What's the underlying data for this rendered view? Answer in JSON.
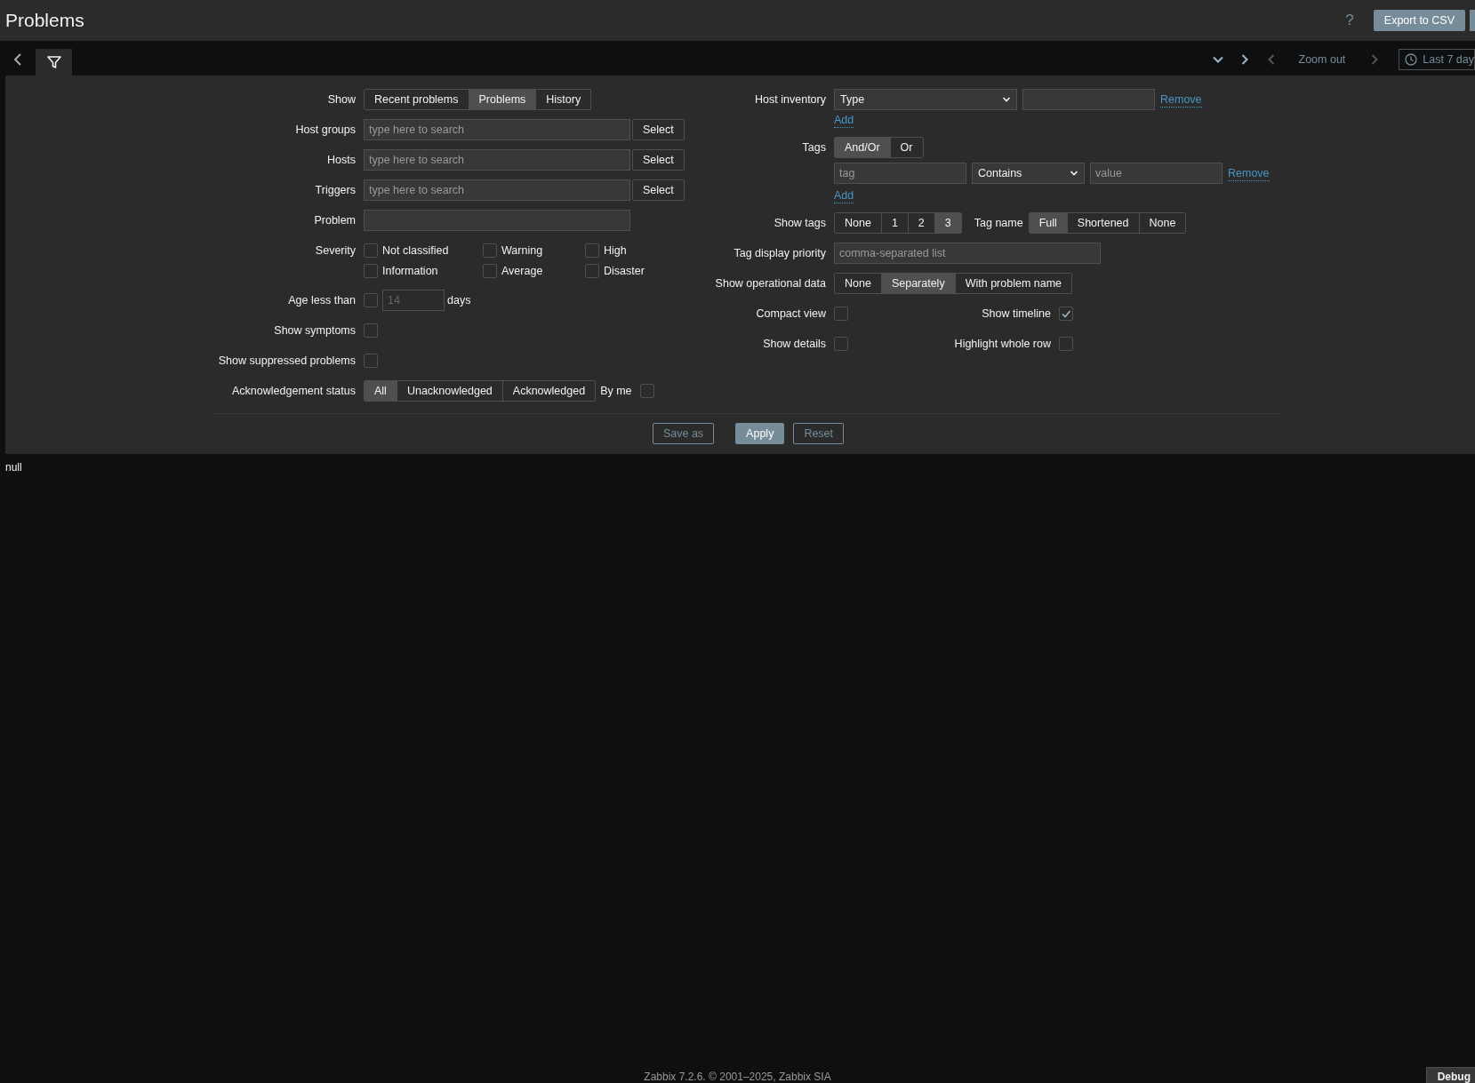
{
  "header": {
    "title": "Problems",
    "help": "?",
    "export_button": "Export to CSV"
  },
  "tab_bar": {
    "tabs": [
      {
        "kind": "filter",
        "selected": true
      }
    ],
    "zoom_out": "Zoom out",
    "time_range": "Last 7 day"
  },
  "filter": {
    "left": [
      {
        "kind": "segmented",
        "label": "Show",
        "options": [
          {
            "label": "Recent problems",
            "selected": false
          },
          {
            "label": "Problems",
            "selected": true
          },
          {
            "label": "History",
            "selected": false
          }
        ]
      },
      {
        "kind": "multiselect",
        "label": "Host groups",
        "placeholder": "type here to search",
        "button": "Select"
      },
      {
        "kind": "multiselect",
        "label": "Hosts",
        "placeholder": "type here to search",
        "button": "Select"
      },
      {
        "kind": "multiselect",
        "label": "Triggers",
        "placeholder": "type here to search",
        "button": "Select"
      },
      {
        "kind": "text",
        "label": "Problem"
      },
      {
        "kind": "checkgrid",
        "label": "Severity",
        "options": [
          {
            "label": "Not classified",
            "checked": false
          },
          {
            "label": "Warning",
            "checked": false
          },
          {
            "label": "High",
            "checked": false
          },
          {
            "label": "Information",
            "checked": false
          },
          {
            "label": "Average",
            "checked": false
          },
          {
            "label": "Disaster",
            "checked": false
          }
        ]
      },
      {
        "kind": "age",
        "label": "Age less than",
        "checked": false,
        "value": "14",
        "disabled": true,
        "unit": "days"
      },
      {
        "kind": "checkbox",
        "label": "Show symptoms",
        "checked": false
      },
      {
        "kind": "checkbox",
        "label": "Show suppressed problems",
        "checked": false
      },
      {
        "kind": "segmented",
        "label": "Acknowledgement status",
        "options": [
          {
            "label": "All",
            "selected": true
          },
          {
            "label": "Unacknowledged",
            "selected": false
          },
          {
            "label": "Acknowledged",
            "selected": false
          }
        ],
        "extra": {
          "label": "By me",
          "checked": false
        }
      }
    ],
    "right": [
      {
        "kind": "inventory",
        "label": "Host inventory",
        "select": "Type",
        "remove": "Remove",
        "add": "Add"
      },
      {
        "kind": "tags",
        "label": "Tags",
        "options": [
          {
            "label": "And/Or",
            "selected": true
          },
          {
            "label": "Or",
            "selected": false
          }
        ],
        "tag_placeholder": "tag",
        "operator": "Contains",
        "value_placeholder": "value",
        "remove": "Remove",
        "add": "Add"
      },
      {
        "kind": "showtags",
        "label": "Show tags",
        "options": [
          {
            "label": "None",
            "selected": false
          },
          {
            "label": "1",
            "selected": false
          },
          {
            "label": "2",
            "selected": false
          },
          {
            "label": "3",
            "selected": true
          }
        ],
        "label2": "Tag name",
        "options2": [
          {
            "label": "Full",
            "selected": true
          },
          {
            "label": "Shortened",
            "selected": false
          },
          {
            "label": "None",
            "selected": false
          }
        ]
      },
      {
        "kind": "text",
        "label": "Tag display priority",
        "placeholder": "comma-separated list"
      },
      {
        "kind": "segmented",
        "label": "Show operational data",
        "options": [
          {
            "label": "None",
            "selected": false
          },
          {
            "label": "Separately",
            "selected": true
          },
          {
            "label": "With problem name",
            "selected": false
          }
        ]
      },
      {
        "kind": "checkpair",
        "label": "Compact view",
        "checked": false,
        "label2": "Show timeline",
        "checked2": true
      },
      {
        "kind": "checkpair",
        "label": "Show details",
        "checked": false,
        "label2": "Highlight whole row",
        "checked2": false
      }
    ]
  },
  "actions": [
    {
      "label": "Save as",
      "kind": "secondary"
    },
    {
      "label": "Apply",
      "kind": "primary"
    },
    {
      "label": "Reset",
      "kind": "secondary"
    }
  ],
  "content": "null",
  "footer": {
    "text": "Zabbix 7.2.6. © 2001–2025, ",
    "link": "Zabbix SIA"
  },
  "debug_button": "Debug"
}
